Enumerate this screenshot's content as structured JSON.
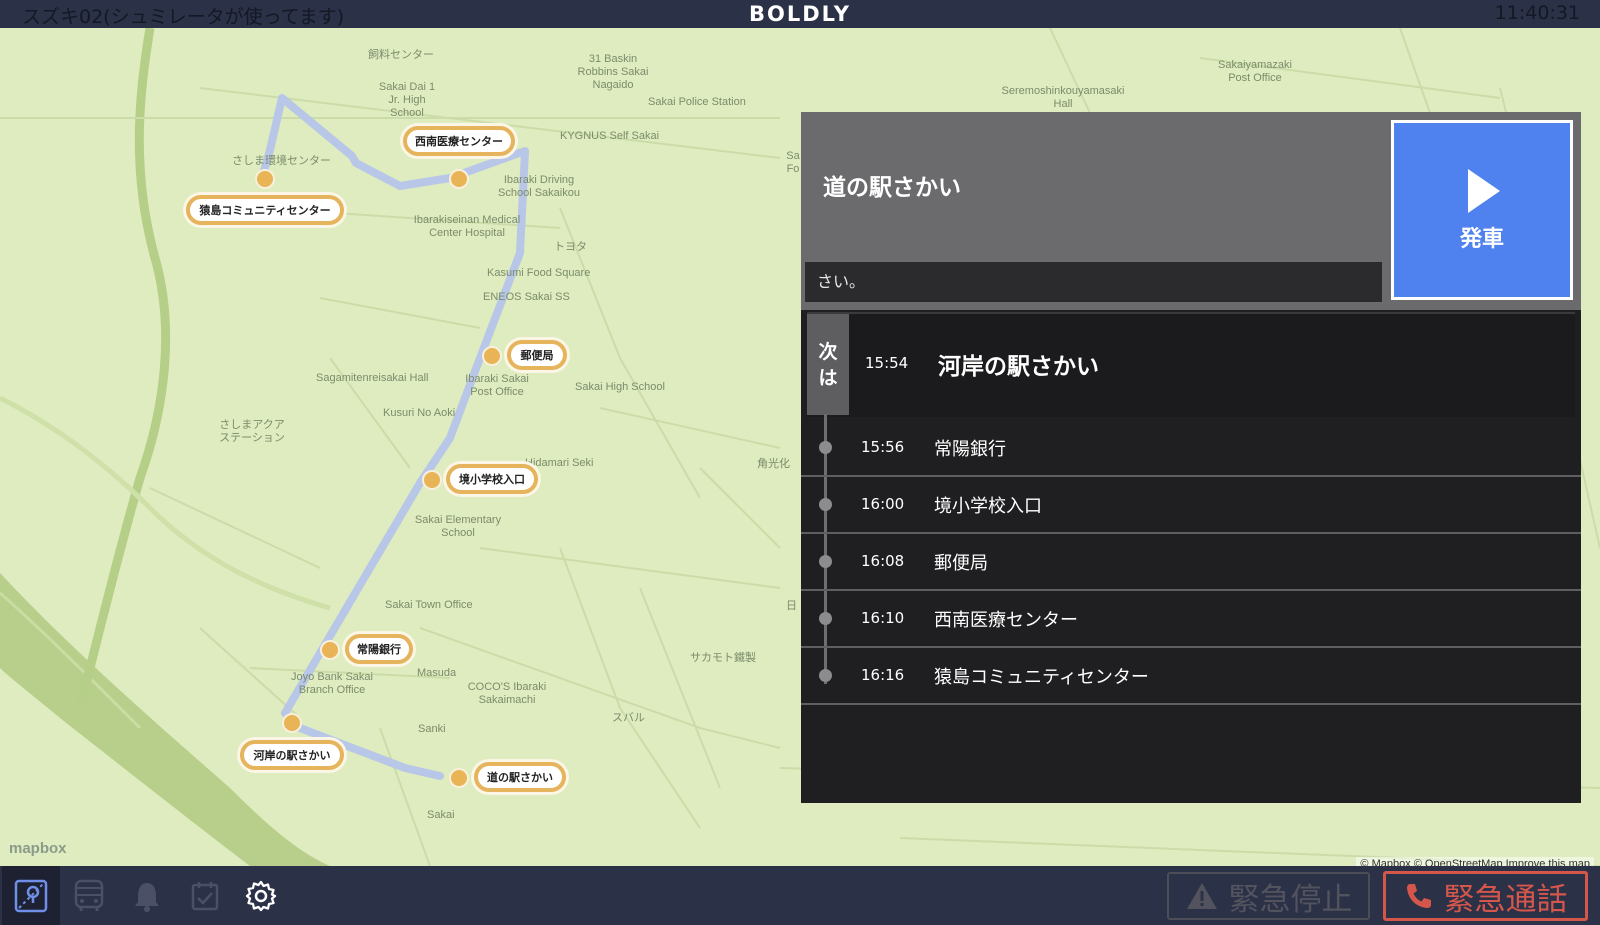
{
  "header": {
    "vehicle_status": "スズキ02(シュミレータが使ってます)",
    "brand": "BOLDLY",
    "clock": "11:40:31"
  },
  "map": {
    "place_labels": [
      "飼料センター",
      "Sakai Dai 1 Jr. High School",
      "31 Baskin Robbins Sakai Nagaido",
      "Sakai Police Station",
      "KYGNUS Self Sakai",
      "Sakaiyamazaki Post Office",
      "Seremoshinkouyamasaki Hall",
      "さしま環境センター",
      "Ibaraki Driving School Sakaikou",
      "Ibarakiseinan Medical Center Hospital",
      "トヨタ",
      "Kasumi Food Square",
      "ENEOS Sakai SS",
      "Sagamitenreisakai Hall",
      "Sakai High School",
      "Kusuri No Aoki",
      "さしまアクア ステーション",
      "角光化",
      "Sakai Elementary School",
      "Sakai Town Office",
      "サカモト鐵製",
      "Masuda",
      "COCO'S Ibaraki Sakaimachi",
      "スバル",
      "Sanki",
      "Sakai",
      "Joyo Bank Sakai Branch Office",
      "Ibaraki Sakai Post Office",
      "Hidamari Seki",
      "Sa Fo",
      "日"
    ],
    "route_stops": [
      {
        "name": "西南医療センター"
      },
      {
        "name": "猿島コミュニティセンター"
      },
      {
        "name": "郵便局"
      },
      {
        "name": "境小学校入口"
      },
      {
        "name": "常陽銀行"
      },
      {
        "name": "河岸の駅さかい"
      },
      {
        "name": "道の駅さかい"
      }
    ],
    "logo": "mapbox",
    "attribution": "© Mapbox © OpenStreetMap Improve this map",
    "colors": {
      "land": "#dfecbf",
      "route": "#b8c6e8",
      "stop": "#e9b456",
      "river": "#b7cf8a"
    }
  },
  "panel": {
    "destination": "道の駅さかい",
    "message": "さい。",
    "depart_button": "発車",
    "next": {
      "tag_line1": "次",
      "tag_line2": "は",
      "time": "15:54",
      "name": "河岸の駅さかい"
    },
    "upcoming": [
      {
        "time": "15:56",
        "name": "常陽銀行"
      },
      {
        "time": "16:00",
        "name": "境小学校入口"
      },
      {
        "time": "16:08",
        "name": "郵便局"
      },
      {
        "time": "16:10",
        "name": "西南医療センター"
      },
      {
        "time": "16:16",
        "name": "猿島コミュニティセンター"
      }
    ],
    "colors": {
      "depart": "#4f82ee",
      "background": "#1f1f21"
    }
  },
  "footer": {
    "nav_icons": [
      "map-icon",
      "bus-icon",
      "bell-icon",
      "checklist-icon",
      "settings-gear-icon"
    ],
    "emergency_stop": "緊急停止",
    "emergency_call": "緊急通話",
    "colors": {
      "emergency_call": "#d5574c"
    }
  }
}
